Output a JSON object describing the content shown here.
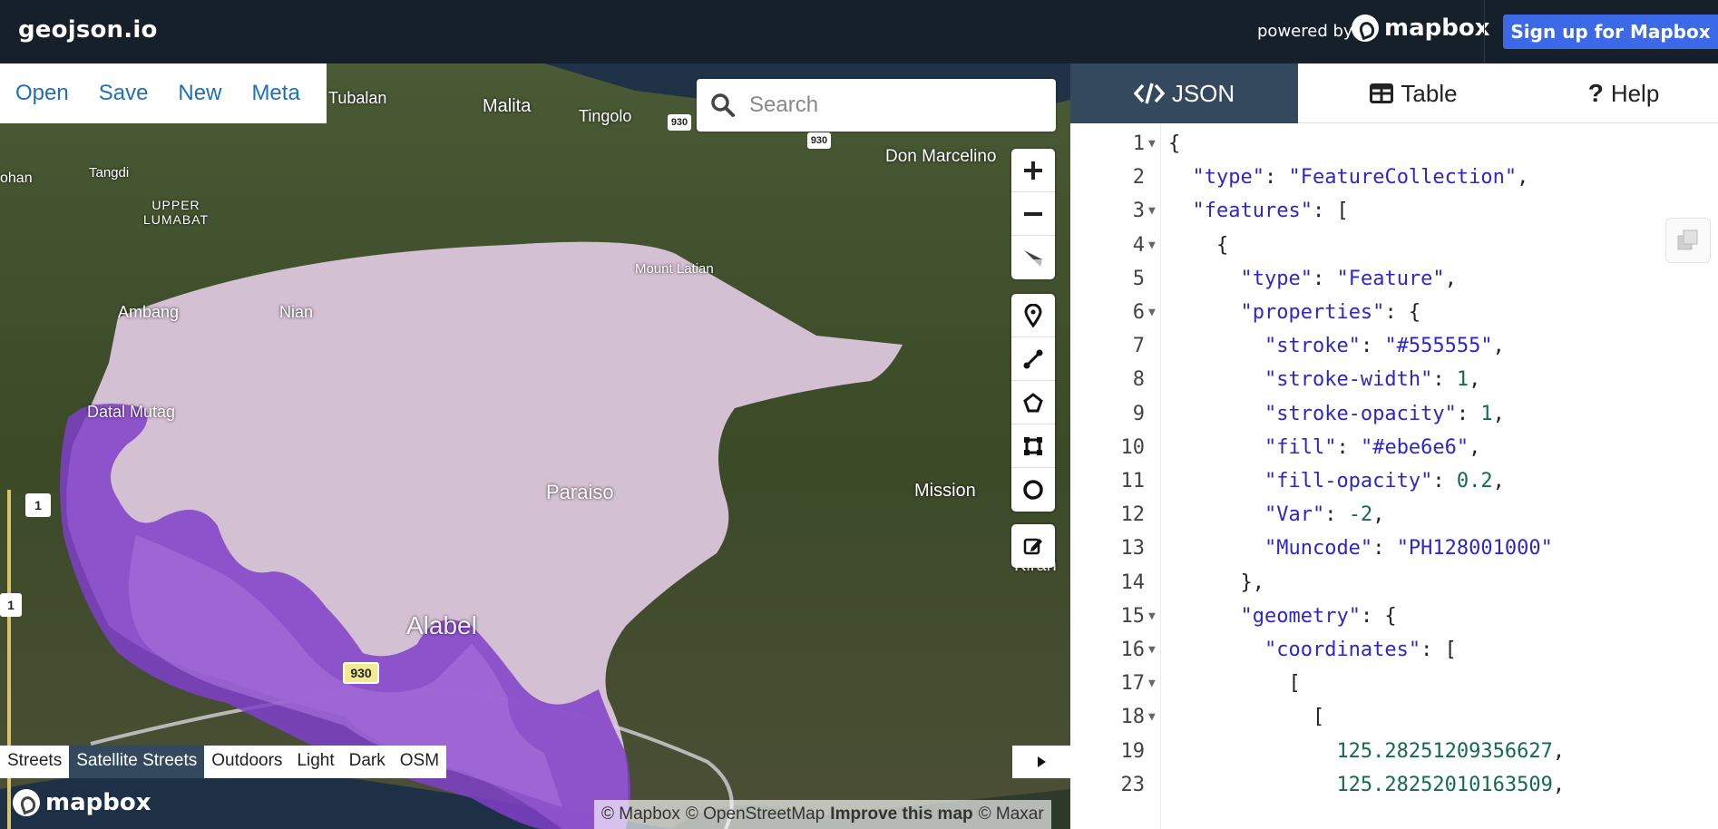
{
  "app": {
    "title": "geojson.io",
    "powered_by": "powered by",
    "mapbox_brand": "mapbox",
    "signup": "Sign up for Mapbox"
  },
  "menu": {
    "items": [
      "Open",
      "Save",
      "New",
      "Meta"
    ]
  },
  "search": {
    "placeholder": "Search"
  },
  "map_controls": [
    "zoom-in",
    "zoom-out",
    "reset-bearing",
    "draw-point",
    "draw-line",
    "draw-polygon",
    "draw-rectangle",
    "draw-circle",
    "edit-features"
  ],
  "map_styles": {
    "items": [
      "Streets",
      "Satellite Streets",
      "Outdoors",
      "Light",
      "Dark",
      "OSM"
    ],
    "active": "Satellite Streets"
  },
  "map_brand": "mapbox",
  "attribution": {
    "mapbox": "© Mapbox",
    "osm": "© OpenStreetMap",
    "improve": "Improve this map",
    "maxar": "© Maxar"
  },
  "places": {
    "tubalan": "Tubalan",
    "malita": "Malita",
    "tingolo": "Tingolo",
    "don_marcelino": "Don Marcelino",
    "tangdi": "Tangdi",
    "ohan": "ohan",
    "upper_lumabat": "UPPER\nLUMABAT",
    "mount_latian": "Mount Latian",
    "ambang": "Ambang",
    "nian": "Nian",
    "datal_mutag": "Datal Mutag",
    "paraiso": "Paraiso",
    "mission": "Mission",
    "alabel": "Alabel",
    "kiran": "Kiran",
    "road_930_a": "930",
    "road_930_b": "930",
    "road_930_c": "930",
    "road_1_a": "1",
    "road_1_b": "1"
  },
  "tabs": [
    {
      "label": "JSON",
      "icon": "code-icon",
      "active": true
    },
    {
      "label": "Table",
      "icon": "table-icon",
      "active": false
    },
    {
      "label": "Help",
      "icon": "question-icon",
      "active": false
    }
  ],
  "editor_lines": [
    {
      "n": "1",
      "fold": true,
      "text": "{"
    },
    {
      "n": "2",
      "fold": false,
      "text": "  \"type\": \"FeatureCollection\","
    },
    {
      "n": "3",
      "fold": true,
      "text": "  \"features\": ["
    },
    {
      "n": "4",
      "fold": true,
      "text": "    {"
    },
    {
      "n": "5",
      "fold": false,
      "text": "      \"type\": \"Feature\","
    },
    {
      "n": "6",
      "fold": true,
      "text": "      \"properties\": {"
    },
    {
      "n": "7",
      "fold": false,
      "text": "        \"stroke\": \"#555555\","
    },
    {
      "n": "8",
      "fold": false,
      "text": "        \"stroke-width\": 1,"
    },
    {
      "n": "9",
      "fold": false,
      "text": "        \"stroke-opacity\": 1,"
    },
    {
      "n": "10",
      "fold": false,
      "text": "        \"fill\": \"#ebe6e6\","
    },
    {
      "n": "11",
      "fold": false,
      "text": "        \"fill-opacity\": 0.2,"
    },
    {
      "n": "12",
      "fold": false,
      "text": "        \"Var\": -2,"
    },
    {
      "n": "13",
      "fold": false,
      "text": "        \"Muncode\": \"PH128001000\""
    },
    {
      "n": "14",
      "fold": false,
      "text": "      },"
    },
    {
      "n": "15",
      "fold": true,
      "text": "      \"geometry\": {"
    },
    {
      "n": "16",
      "fold": true,
      "text": "        \"coordinates\": ["
    },
    {
      "n": "17",
      "fold": true,
      "text": "          ["
    },
    {
      "n": "18",
      "fold": true,
      "text": "            ["
    },
    {
      "n": "19",
      "fold": false,
      "text": "              125.28251209356627,"
    },
    {
      "n": "23",
      "fold": false,
      "text": "              125.28252010163509,"
    }
  ],
  "colors": {
    "topbar": "#15202b",
    "signup": "#3c69e7",
    "tab_active": "#34495e",
    "link": "#1f6fb5"
  }
}
